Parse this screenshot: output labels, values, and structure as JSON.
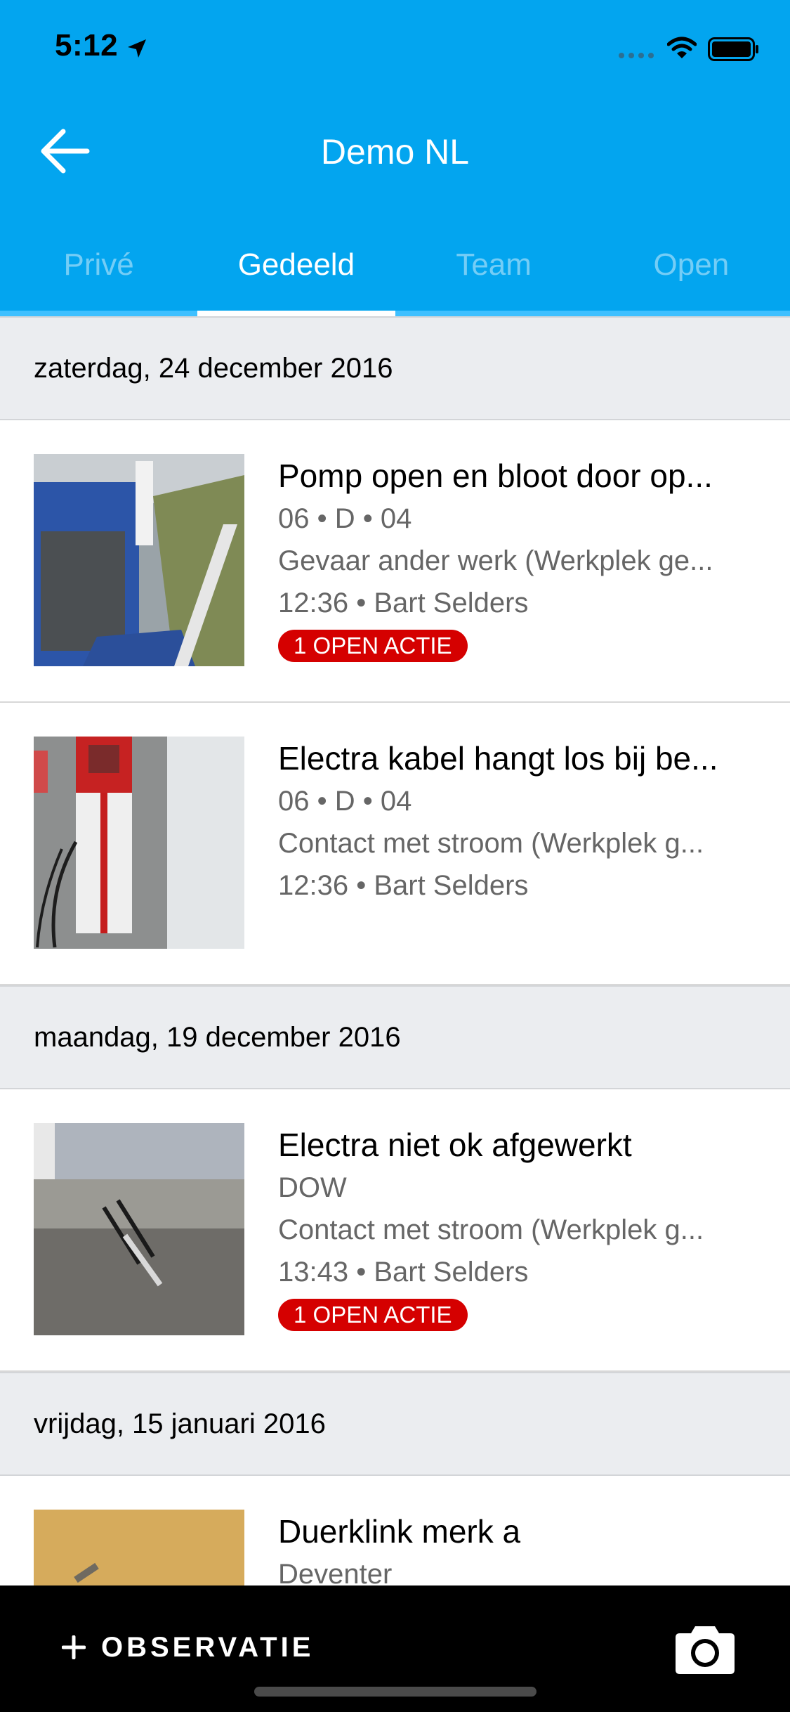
{
  "status_bar": {
    "time": "5:12"
  },
  "nav": {
    "title": "Demo NL"
  },
  "tabs": [
    {
      "label": "Privé",
      "active": false
    },
    {
      "label": "Gedeeld",
      "active": true
    },
    {
      "label": "Team",
      "active": false
    },
    {
      "label": "Open",
      "active": false
    }
  ],
  "sections": [
    {
      "date": "zaterdag, 24 december 2016",
      "items": [
        {
          "title": "Pomp open en bloot door op...",
          "location": "06 • D • 04",
          "category": "Gevaar ander werk (Werkplek ge...",
          "meta": "12:36 • Bart Selders",
          "badge": "1 OPEN ACTIE"
        },
        {
          "title": "Electra kabel hangt los bij be...",
          "location": "06 • D • 04",
          "category": "Contact met stroom (Werkplek g...",
          "meta": "12:36 • Bart Selders",
          "badge": ""
        }
      ]
    },
    {
      "date": "maandag, 19 december 2016",
      "items": [
        {
          "title": "Electra niet ok afgewerkt",
          "location": "DOW",
          "category": "Contact met stroom (Werkplek g...",
          "meta": "13:43 • Bart Selders",
          "badge": "1 OPEN ACTIE"
        }
      ]
    },
    {
      "date": "vrijdag, 15 januari 2016",
      "items": [
        {
          "title": "Duerklink merk a",
          "location": "Deventer",
          "category": "",
          "meta": "",
          "badge": ""
        }
      ]
    }
  ],
  "bottom_bar": {
    "observation_label": "OBSERVATIE"
  },
  "colors": {
    "primary": "#03a5ef",
    "badge": "#d50000",
    "section_bg": "#ebedf0"
  }
}
